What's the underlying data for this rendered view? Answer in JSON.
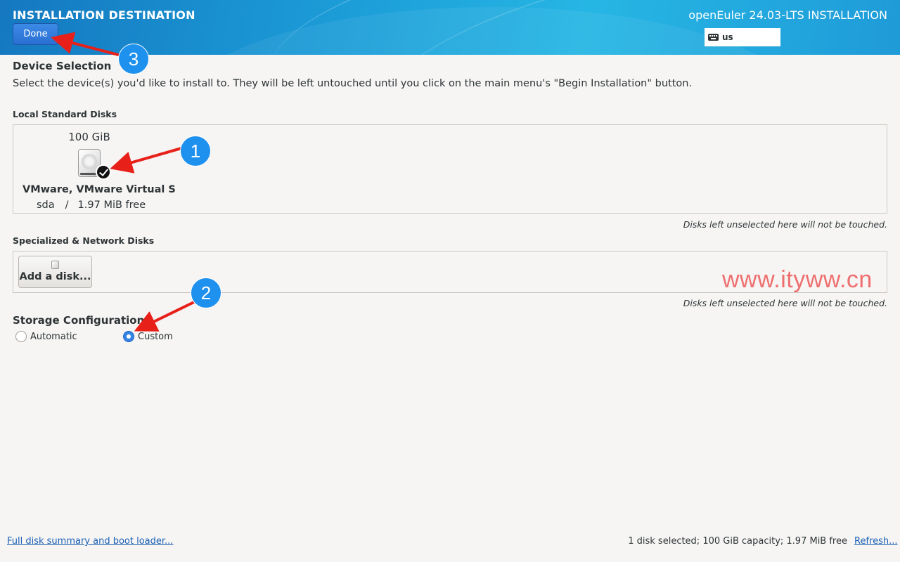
{
  "header": {
    "title": "INSTALLATION DESTINATION",
    "done_label": "Done",
    "product": "openEuler 24.03-LTS INSTALLATION",
    "keyboard_layout": "us"
  },
  "device_selection": {
    "title": "Device Selection",
    "description": "Select the device(s) you'd like to install to.  They will be left untouched until you click on the main menu's \"Begin Installation\" button."
  },
  "local_disks": {
    "title": "Local Standard Disks",
    "disks": [
      {
        "size": "100 GiB",
        "name": "VMware, VMware Virtual S",
        "device": "sda",
        "separator": "/",
        "free": "1.97 MiB free",
        "selected": true
      }
    ],
    "note": "Disks left unselected here will not be touched."
  },
  "network_disks": {
    "title": "Specialized & Network Disks",
    "add_label": "Add a disk...",
    "note": "Disks left unselected here will not be touched."
  },
  "storage_configuration": {
    "title": "Storage Configuration",
    "options": [
      {
        "label": "Automatic",
        "selected": false
      },
      {
        "label": "Custom",
        "selected": true
      }
    ]
  },
  "footer": {
    "summary_link": "Full disk summary and boot loader...",
    "status": "1 disk selected; 100 GiB capacity; 1.97 MiB free",
    "refresh_link": "Refresh..."
  },
  "watermark": "www.ityww.cn",
  "annotations": [
    "1",
    "2",
    "3"
  ],
  "colors": {
    "accent": "#3584e4",
    "annotation": "#1e90ee",
    "arrow": "#e8201a",
    "link": "#1a5fb4",
    "watermark": "#ef6f6f"
  }
}
